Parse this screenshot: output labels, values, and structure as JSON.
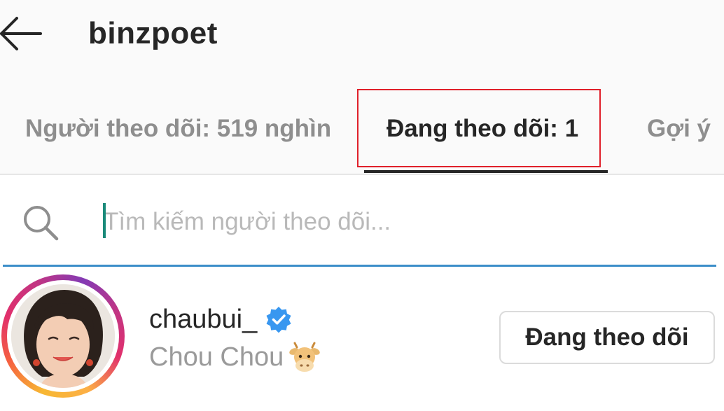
{
  "header": {
    "title": "binzpoet",
    "back_icon": "arrow-left-icon"
  },
  "tabs": [
    {
      "label": "Người theo dõi: 519 nghìn",
      "active": false
    },
    {
      "label": "Đang theo dõi: 1",
      "active": true
    },
    {
      "label": "Gợi ý",
      "active": false
    }
  ],
  "search": {
    "placeholder": "Tìm kiếm người theo dõi...",
    "value": "",
    "icon": "search-icon"
  },
  "list": [
    {
      "username": "chaubui_",
      "verified": true,
      "full_name": "Chou Chou",
      "name_emoji": "cow-face-icon",
      "button_label": "Đang theo dõi"
    }
  ],
  "colors": {
    "accent_blue": "#3b8ec9",
    "verified_blue": "#3897f0",
    "highlight_red": "#e0202a",
    "text_dark": "#262626",
    "text_muted": "#8e8e8e"
  }
}
